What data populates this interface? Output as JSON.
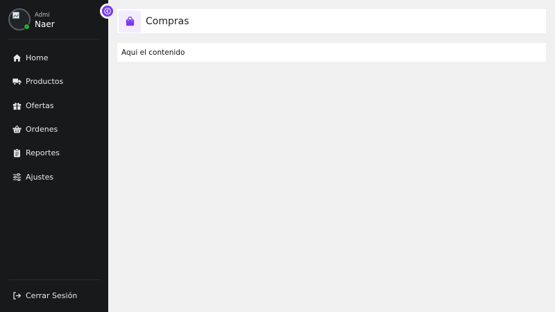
{
  "user": {
    "role": "Admi",
    "name": "Naer"
  },
  "nav": {
    "items": [
      {
        "label": "Home",
        "icon": "home-icon"
      },
      {
        "label": "Productos",
        "icon": "truck-icon"
      },
      {
        "label": "Ofertas",
        "icon": "gift-icon"
      },
      {
        "label": "Ordenes",
        "icon": "basket-icon"
      },
      {
        "label": "Reportes",
        "icon": "clipboard-icon"
      },
      {
        "label": "Ajustes",
        "icon": "sliders-icon"
      }
    ],
    "logout": {
      "label": "Cerrar Sesión",
      "icon": "sign-out-icon"
    }
  },
  "header": {
    "title": "Compras",
    "icon": "shopping-bag-icon"
  },
  "content": {
    "text": "Aqui el contenido"
  },
  "colors": {
    "accent": "#7c3aed",
    "sidebar_bg": "#18191b",
    "page_bg": "#f0f0f0",
    "status_online": "#1ea83c"
  }
}
